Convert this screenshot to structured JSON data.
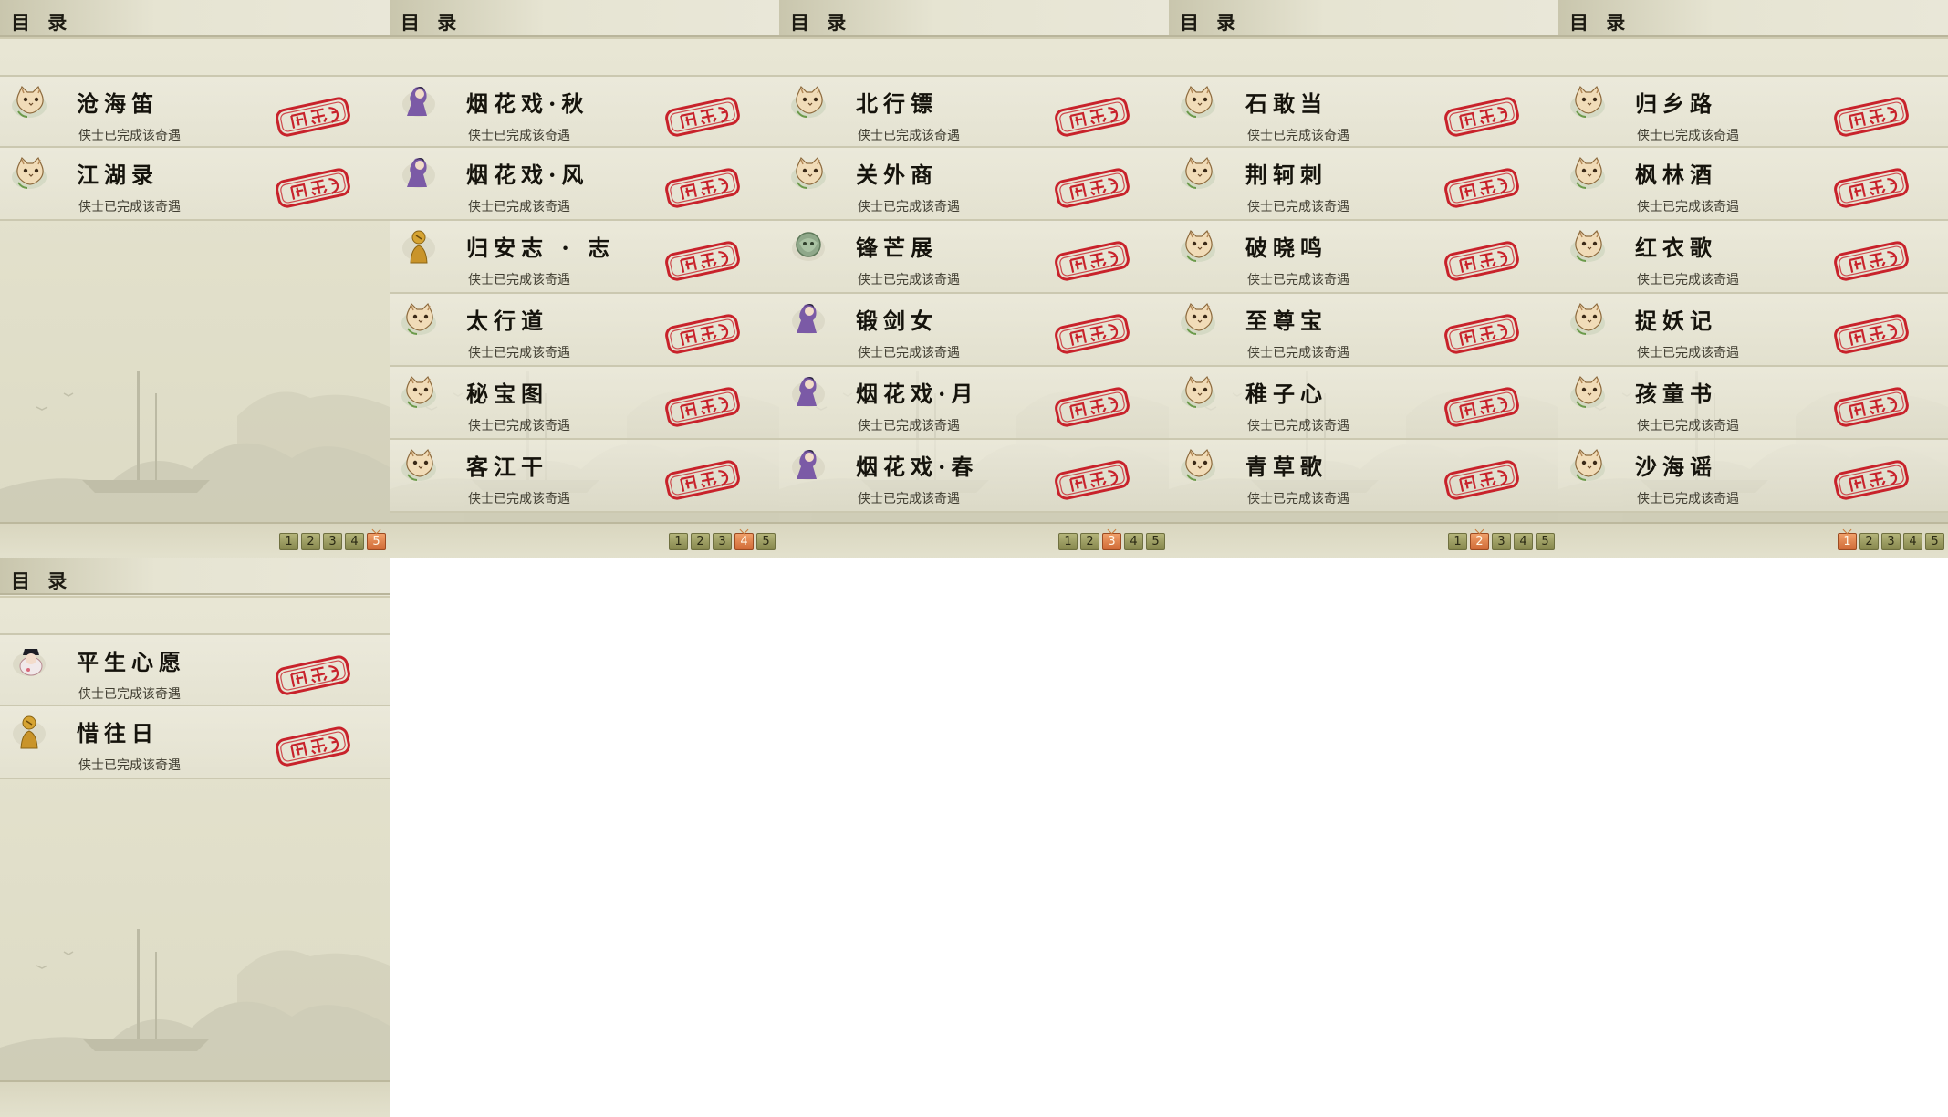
{
  "colors": {
    "stamp_red": "#c8222b",
    "page_active": "#d87a45"
  },
  "panels": [
    {
      "title": "目 录",
      "entries": [
        {
          "name": "沧海笛",
          "status": "侠士已完成该奇遇",
          "avatar": "cat-avatar-icon",
          "stamp": "completed-stamp-icon"
        },
        {
          "name": "江湖录",
          "status": "侠士已完成该奇遇",
          "avatar": "cat-avatar-icon",
          "stamp": "completed-stamp-icon"
        }
      ],
      "pages": [
        "1",
        "2",
        "3",
        "4",
        "5"
      ],
      "current_page": 5
    },
    {
      "title": "目 录",
      "entries": [
        {
          "name": "烟花戏·秋",
          "status": "侠士已完成该奇遇",
          "avatar": "lady-avatar-icon",
          "stamp": "completed-stamp-icon"
        },
        {
          "name": "烟花戏·风",
          "status": "侠士已完成该奇遇",
          "avatar": "lady-avatar-icon",
          "stamp": "completed-stamp-icon"
        },
        {
          "name": "归安志 · 志",
          "status": "侠士已完成该奇遇",
          "avatar": "golden-figure-avatar-icon",
          "stamp": "completed-stamp-icon"
        },
        {
          "name": "太行道",
          "status": "侠士已完成该奇遇",
          "avatar": "cat-avatar-icon",
          "stamp": "completed-stamp-icon"
        },
        {
          "name": "秘宝图",
          "status": "侠士已完成该奇遇",
          "avatar": "cat-avatar-icon",
          "stamp": "completed-stamp-icon"
        },
        {
          "name": "客江干",
          "status": "侠士已完成该奇遇",
          "avatar": "cat-avatar-icon",
          "stamp": "completed-stamp-icon"
        }
      ],
      "pages": [
        "1",
        "2",
        "3",
        "4",
        "5"
      ],
      "current_page": 4
    },
    {
      "title": "目 录",
      "entries": [
        {
          "name": "北行镖",
          "status": "侠士已完成该奇遇",
          "avatar": "cat-avatar-icon",
          "stamp": "completed-stamp-icon"
        },
        {
          "name": "关外商",
          "status": "侠士已完成该奇遇",
          "avatar": "cat-avatar-icon",
          "stamp": "completed-stamp-icon"
        },
        {
          "name": "锋芒展",
          "status": "侠士已完成该奇遇",
          "avatar": "jade-beast-avatar-icon",
          "stamp": "completed-stamp-icon"
        },
        {
          "name": "锻剑女",
          "status": "侠士已完成该奇遇",
          "avatar": "lady-avatar-icon",
          "stamp": "completed-stamp-icon"
        },
        {
          "name": "烟花戏·月",
          "status": "侠士已完成该奇遇",
          "avatar": "lady-avatar-icon",
          "stamp": "completed-stamp-icon"
        },
        {
          "name": "烟花戏·春",
          "status": "侠士已完成该奇遇",
          "avatar": "lady-avatar-icon",
          "stamp": "completed-stamp-icon"
        }
      ],
      "pages": [
        "1",
        "2",
        "3",
        "4",
        "5"
      ],
      "current_page": 3
    },
    {
      "title": "目 录",
      "entries": [
        {
          "name": "石敢当",
          "status": "侠士已完成该奇遇",
          "avatar": "cat-avatar-icon",
          "stamp": "completed-stamp-icon"
        },
        {
          "name": "荆轲刺",
          "status": "侠士已完成该奇遇",
          "avatar": "cat-avatar-icon",
          "stamp": "completed-stamp-icon"
        },
        {
          "name": "破晓鸣",
          "status": "侠士已完成该奇遇",
          "avatar": "cat-avatar-icon",
          "stamp": "completed-stamp-icon"
        },
        {
          "name": "至尊宝",
          "status": "侠士已完成该奇遇",
          "avatar": "cat-avatar-icon",
          "stamp": "completed-stamp-icon"
        },
        {
          "name": "稚子心",
          "status": "侠士已完成该奇遇",
          "avatar": "cat-avatar-icon",
          "stamp": "completed-stamp-icon"
        },
        {
          "name": "青草歌",
          "status": "侠士已完成该奇遇",
          "avatar": "cat-avatar-icon",
          "stamp": "completed-stamp-icon"
        }
      ],
      "pages": [
        "1",
        "2",
        "3",
        "4",
        "5"
      ],
      "current_page": 2
    },
    {
      "title": "目 录",
      "entries": [
        {
          "name": "归乡路",
          "status": "侠士已完成该奇遇",
          "avatar": "cat-avatar-icon",
          "stamp": "completed-stamp-icon"
        },
        {
          "name": "枫林酒",
          "status": "侠士已完成该奇遇",
          "avatar": "cat-avatar-icon",
          "stamp": "completed-stamp-icon"
        },
        {
          "name": "红衣歌",
          "status": "侠士已完成该奇遇",
          "avatar": "cat-avatar-icon",
          "stamp": "completed-stamp-icon"
        },
        {
          "name": "捉妖记",
          "status": "侠士已完成该奇遇",
          "avatar": "cat-avatar-icon",
          "stamp": "completed-stamp-icon"
        },
        {
          "name": "孩童书",
          "status": "侠士已完成该奇遇",
          "avatar": "cat-avatar-icon",
          "stamp": "completed-stamp-icon"
        },
        {
          "name": "沙海谣",
          "status": "侠士已完成该奇遇",
          "avatar": "cat-avatar-icon",
          "stamp": "completed-stamp-icon"
        }
      ],
      "pages": [
        "1",
        "2",
        "3",
        "4",
        "5"
      ],
      "current_page": 1
    },
    {
      "title": "目 录",
      "entries": [
        {
          "name": "平生心愿",
          "status": "侠士已完成该奇遇",
          "avatar": "scholar-avatar-icon",
          "stamp": "completed-stamp-icon"
        },
        {
          "name": "惜往日",
          "status": "侠士已完成该奇遇",
          "avatar": "golden-figure-avatar-icon",
          "stamp": "completed-stamp-icon"
        }
      ],
      "pages": [],
      "current_page": null
    }
  ]
}
